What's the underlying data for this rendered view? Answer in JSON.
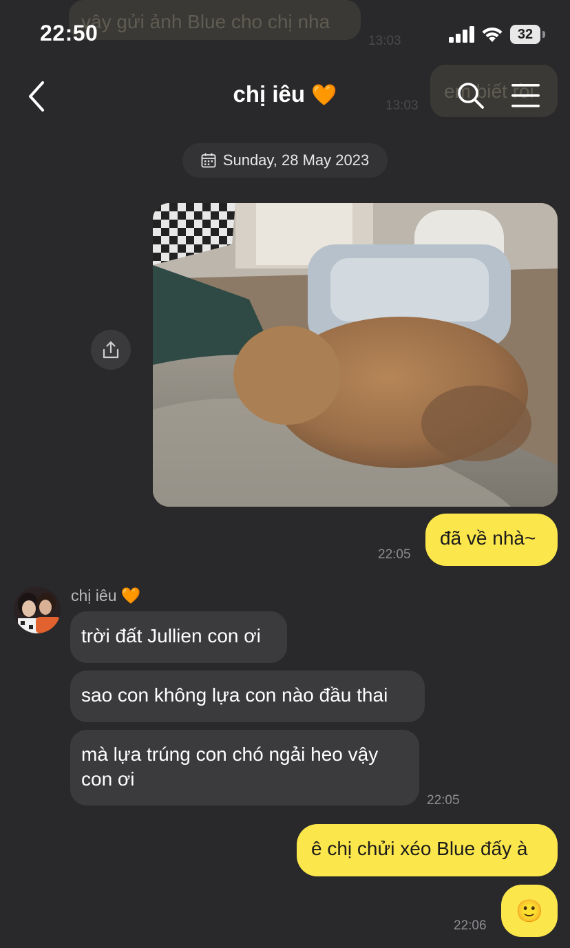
{
  "status_bar": {
    "time": "22:50",
    "battery": "32",
    "icons": [
      "cellular-signal-icon",
      "wifi-icon",
      "battery-icon"
    ]
  },
  "background_messages": {
    "message_1": "vậy gửi ảnh Blue cho chị nha",
    "time_1": "13:03",
    "message_2_visible": "em biết rồi",
    "time_2": "13:03"
  },
  "header": {
    "title": "chị iêu",
    "title_emoji": "🧡",
    "icons": [
      "back-chevron-icon",
      "search-icon",
      "menu-icon"
    ]
  },
  "date_separator": "Sunday, 28 May 2023",
  "messages": {
    "outgoing_1": {
      "text": "đã về nhà~",
      "time": "22:05"
    },
    "sender": {
      "name": "chị iêu",
      "emoji": "🧡"
    },
    "incoming_1": {
      "text": "trời đất Jullien con ơi"
    },
    "incoming_2": {
      "text": "sao con không lựa con nào đầu thai"
    },
    "incoming_3": {
      "text": "mà lựa trúng con chó ngải heo vậy con ơi",
      "time": "22:05"
    },
    "outgoing_2": {
      "text": "ê chị chửi xéo Blue đấy à"
    },
    "outgoing_3": {
      "text": "🙂",
      "time": "22:06"
    }
  },
  "colors": {
    "background": "#29292b",
    "outgoing_bubble": "#fbe64b",
    "incoming_bubble": "#3b3b3e",
    "timestamp": "#8d8d92"
  }
}
